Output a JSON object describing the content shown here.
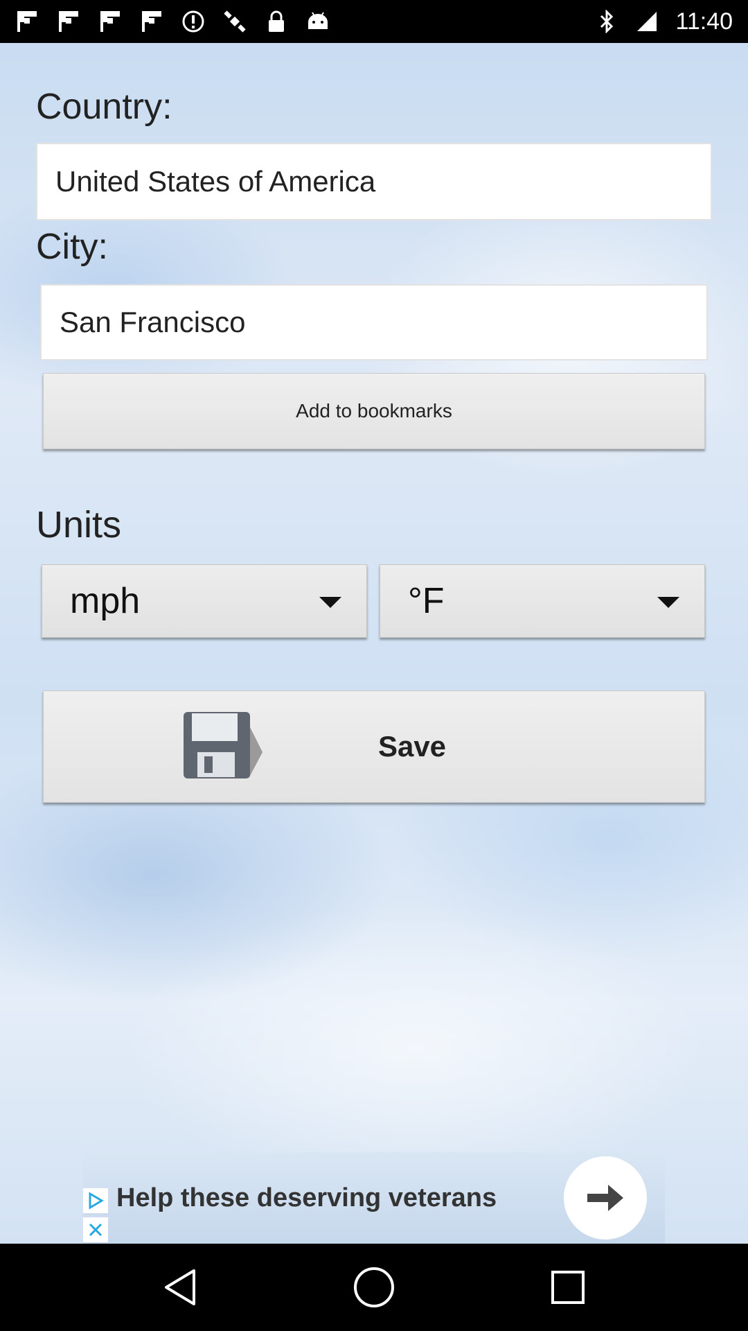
{
  "status_bar": {
    "time": "11:40",
    "icons": [
      "flipboard-icon",
      "flipboard-icon",
      "flipboard-icon",
      "flipboard-icon",
      "alert-icon",
      "satellite-icon",
      "lock-icon",
      "android-icon",
      "bluetooth-icon",
      "signal-icon"
    ]
  },
  "form": {
    "country_label": "Country:",
    "country_value": "United States of America",
    "city_label": "City:",
    "city_value": "San Francisco",
    "bookmark_button": "Add to bookmarks",
    "units_label": "Units",
    "speed_unit": "mph",
    "temp_unit": "°F",
    "save_button": "Save"
  },
  "ad": {
    "text": "Help these deserving veterans"
  },
  "nav_bar": {
    "buttons": [
      "back-icon",
      "home-icon",
      "recents-icon"
    ]
  }
}
